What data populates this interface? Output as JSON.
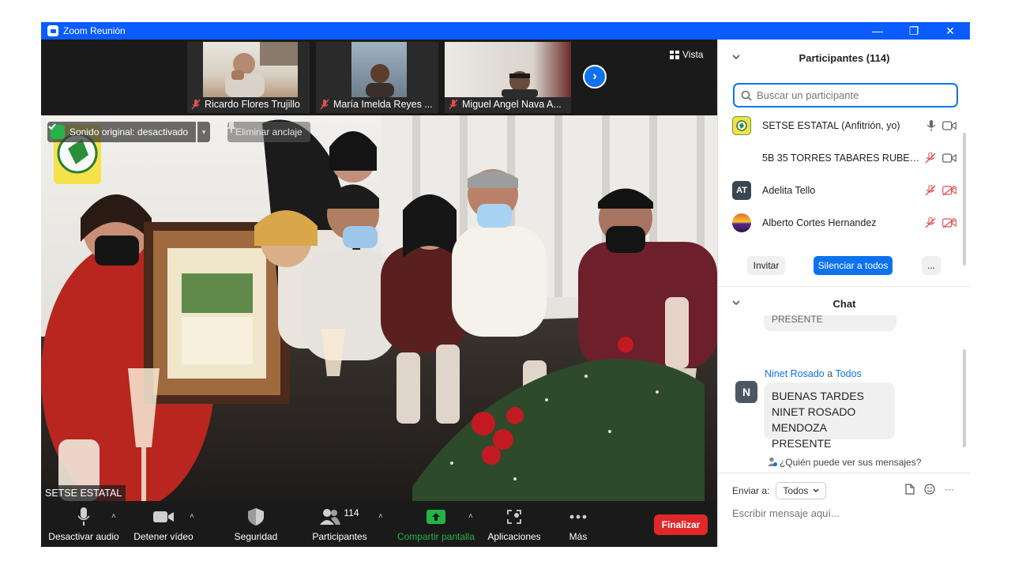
{
  "window": {
    "title": "Zoom Reunión",
    "minimize": "—",
    "maximize": "❐",
    "close": "✕"
  },
  "strip": {
    "participants": [
      {
        "name": "Ricardo Flores Trujillo"
      },
      {
        "name": "María Imelda Reyes ..."
      },
      {
        "name": "Miguel Angel Nava A..."
      }
    ],
    "next": "›",
    "view_label": "Vista"
  },
  "main_video": {
    "sound_label": "Sonido original: desactivado",
    "caret": "▾",
    "unpin_label": "Eliminar anclaje",
    "speaker_name": "SETSE ESTATAL"
  },
  "toolbar": {
    "audio": "Desactivar audio",
    "video": "Detener vídeo",
    "security": "Seguridad",
    "participants": "Participantes",
    "participants_count": "114",
    "share": "Compartir pantalla",
    "apps": "Aplicaciones",
    "more": "Más",
    "end": "Finalizar",
    "caret": "˄"
  },
  "participants_panel": {
    "header": "Participantes (114)",
    "search_placeholder": "Buscar un participante",
    "list": [
      {
        "name": "SETSE ESTATAL (Anfitrión, yo)",
        "avatar": ""
      },
      {
        "name": "5B 35 TORRES TABARES RUBEN ...",
        "avatar": ""
      },
      {
        "name": "Adelita Tello",
        "avatar": "AT"
      },
      {
        "name": "Alberto Cortes Hernandez",
        "avatar": ""
      }
    ],
    "invite": "Invitar",
    "mute_all": "Silenciar a todos",
    "more": "..."
  },
  "chat_panel": {
    "header": "Chat",
    "prev_message_fragment": "PRESENTE",
    "sender": "Ninet Rosado",
    "to_word": "a",
    "recipient": "Todos",
    "sender_avatar": "N",
    "message_lines": [
      "BUENAS TARDES",
      "NINET ROSADO",
      "MENDOZA PRESENTE"
    ],
    "who_sees": "¿Quién puede ver sus mensajes?",
    "send_to_label": "Enviar a:",
    "send_to_value": "Todos",
    "more": "···",
    "input_placeholder": "Escribir mensaje aquí..."
  },
  "colors": {
    "zoom_blue": "#0b5cff",
    "accent_blue": "#0e72ed",
    "end_red": "#e02828",
    "share_green": "#25b34a",
    "mute_red": "#e05050"
  }
}
